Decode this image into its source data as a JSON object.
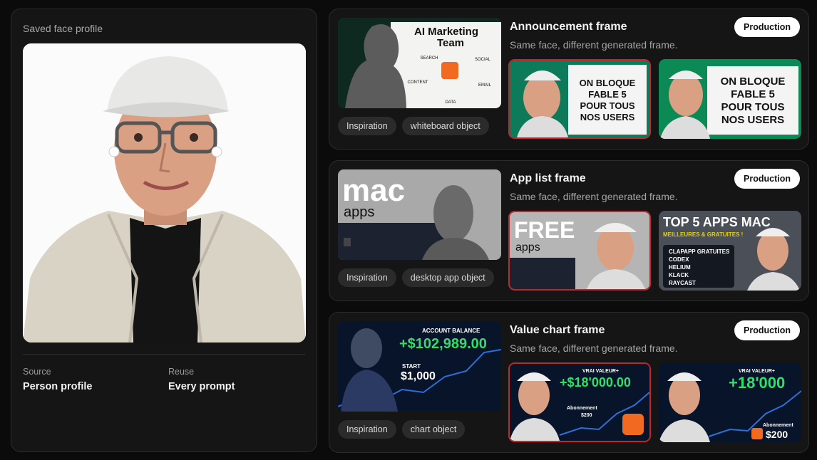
{
  "profile": {
    "label": "Saved face profile",
    "source_label": "Source",
    "source_value": "Person profile",
    "reuse_label": "Reuse",
    "reuse_value": "Every prompt"
  },
  "cards": [
    {
      "title": "Announcement frame",
      "subtitle": "Same face, different generated frame.",
      "badge": "Production",
      "tags": [
        "Inspiration",
        "whiteboard object"
      ],
      "inspiration": {
        "heading_1": "AI Marketing",
        "heading_2": "Team",
        "nodes": [
          "SEARCH",
          "SOCIAL",
          "CONTENT",
          "EMAIL",
          "DATA"
        ]
      },
      "thumb_1": {
        "lines": [
          "ON BLOQUE",
          "FABLE 5",
          "POUR TOUS",
          "NOS USERS"
        ]
      },
      "thumb_2": {
        "lines": [
          "ON BLOQUE",
          "FABLE 5",
          "POUR TOUS",
          "NOS USERS"
        ]
      }
    },
    {
      "title": "App list frame",
      "subtitle": "Same face, different generated frame.",
      "badge": "Production",
      "tags": [
        "Inspiration",
        "desktop app object"
      ],
      "inspiration": {
        "word_1": "mac",
        "word_2": "apps"
      },
      "thumb_1": {
        "word_1": "FREE",
        "word_2": "apps"
      },
      "thumb_2": {
        "title": "TOP 5 APPS MAC",
        "subtitle": "MEILLEURES & GRATUITES !",
        "apps": [
          "CLAPAPP GRATUITES",
          "CODEX",
          "HELIUM",
          "KLACK",
          "RAYCAST"
        ]
      }
    },
    {
      "title": "Value chart frame",
      "subtitle": "Same face, different generated frame.",
      "badge": "Production",
      "tags": [
        "Inspiration",
        "chart object"
      ],
      "inspiration": {
        "caption": "ACCOUNT BALANCE",
        "value": "+$102,989.00",
        "start_label": "START",
        "start_value": "$1,000"
      },
      "thumb_1": {
        "caption": "VRAI VALEUR+",
        "value": "+$18'000.00",
        "sub_1": "Abonnement",
        "sub_2": "$200"
      },
      "thumb_2": {
        "caption": "VRAI VALEUR+",
        "value": "+18'000",
        "sub_1": "Abonnement",
        "sub_2": "$200"
      }
    }
  ]
}
